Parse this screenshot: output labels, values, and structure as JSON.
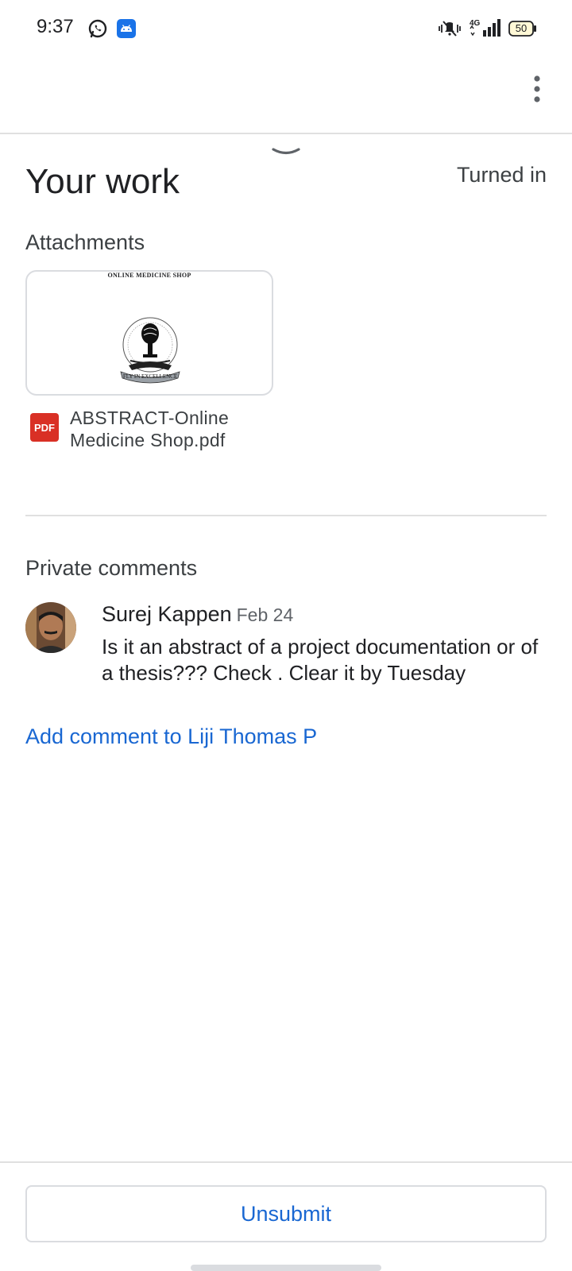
{
  "status_bar": {
    "time": "9:37",
    "battery": "50",
    "icons": [
      "whatsapp-icon",
      "android-app-icon",
      "vibrate-mute-icon",
      "4g-signal-icon",
      "battery-icon"
    ]
  },
  "app_bar": {
    "more_icon": "more-vert-icon"
  },
  "sheet": {
    "title": "Your work",
    "status": "Turned in",
    "attachments_label": "Attachments",
    "attachment": {
      "thumb_heading": "ONLINE MEDICINE SHOP",
      "file_name": "ABSTRACT-Online Medicine Shop.pdf",
      "file_type": "PDF"
    },
    "private_comments_label": "Private comments",
    "comments": [
      {
        "author": "Surej Kappen",
        "date": "Feb 24",
        "text": "Is it an abstract of a project documentation or of a thesis??? Check . Clear it by Tuesday"
      }
    ],
    "add_comment": "Add comment to Liji Thomas P",
    "unsubmit": "Unsubmit"
  },
  "colors": {
    "accent": "#1967d2",
    "pdf_red": "#d93025",
    "divider": "#e0e0e0"
  }
}
